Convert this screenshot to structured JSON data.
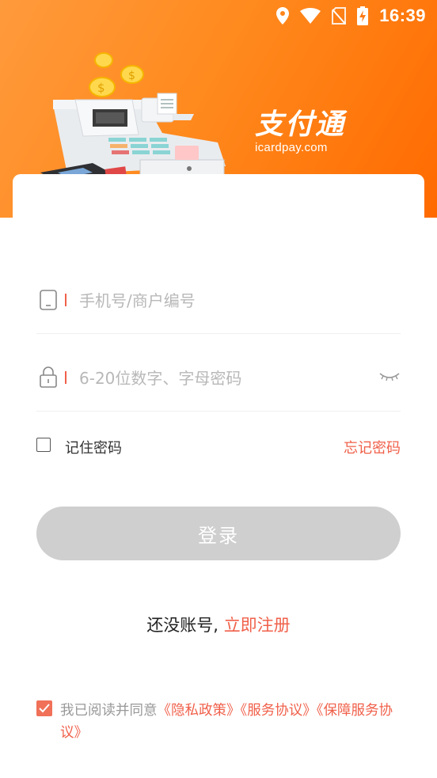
{
  "status_bar": {
    "time": "16:39",
    "icons": [
      "location-icon",
      "wifi-icon",
      "no-sim-icon",
      "battery-charging-icon"
    ]
  },
  "brand": {
    "title": "支付通",
    "domain": "icardpay.com"
  },
  "form": {
    "account_placeholder": "手机号/商户编号",
    "password_placeholder": "6-20位数字、字母密码",
    "remember_label": "记住密码",
    "remember_checked": false,
    "forgot_label": "忘记密码",
    "login_label": "登录"
  },
  "register": {
    "prefix": "还没账号,",
    "link": "立即注册"
  },
  "agreement": {
    "checked": true,
    "prefix": "我已阅读并同意",
    "privacy": "《隐私政策》",
    "service": "《服务协议》",
    "guarantee": "《保障服务协议》"
  },
  "colors": {
    "accent": "#f0604a",
    "header_start": "#ff9a3c",
    "header_end": "#ff6a00",
    "button_disabled": "#cfcfcf"
  }
}
